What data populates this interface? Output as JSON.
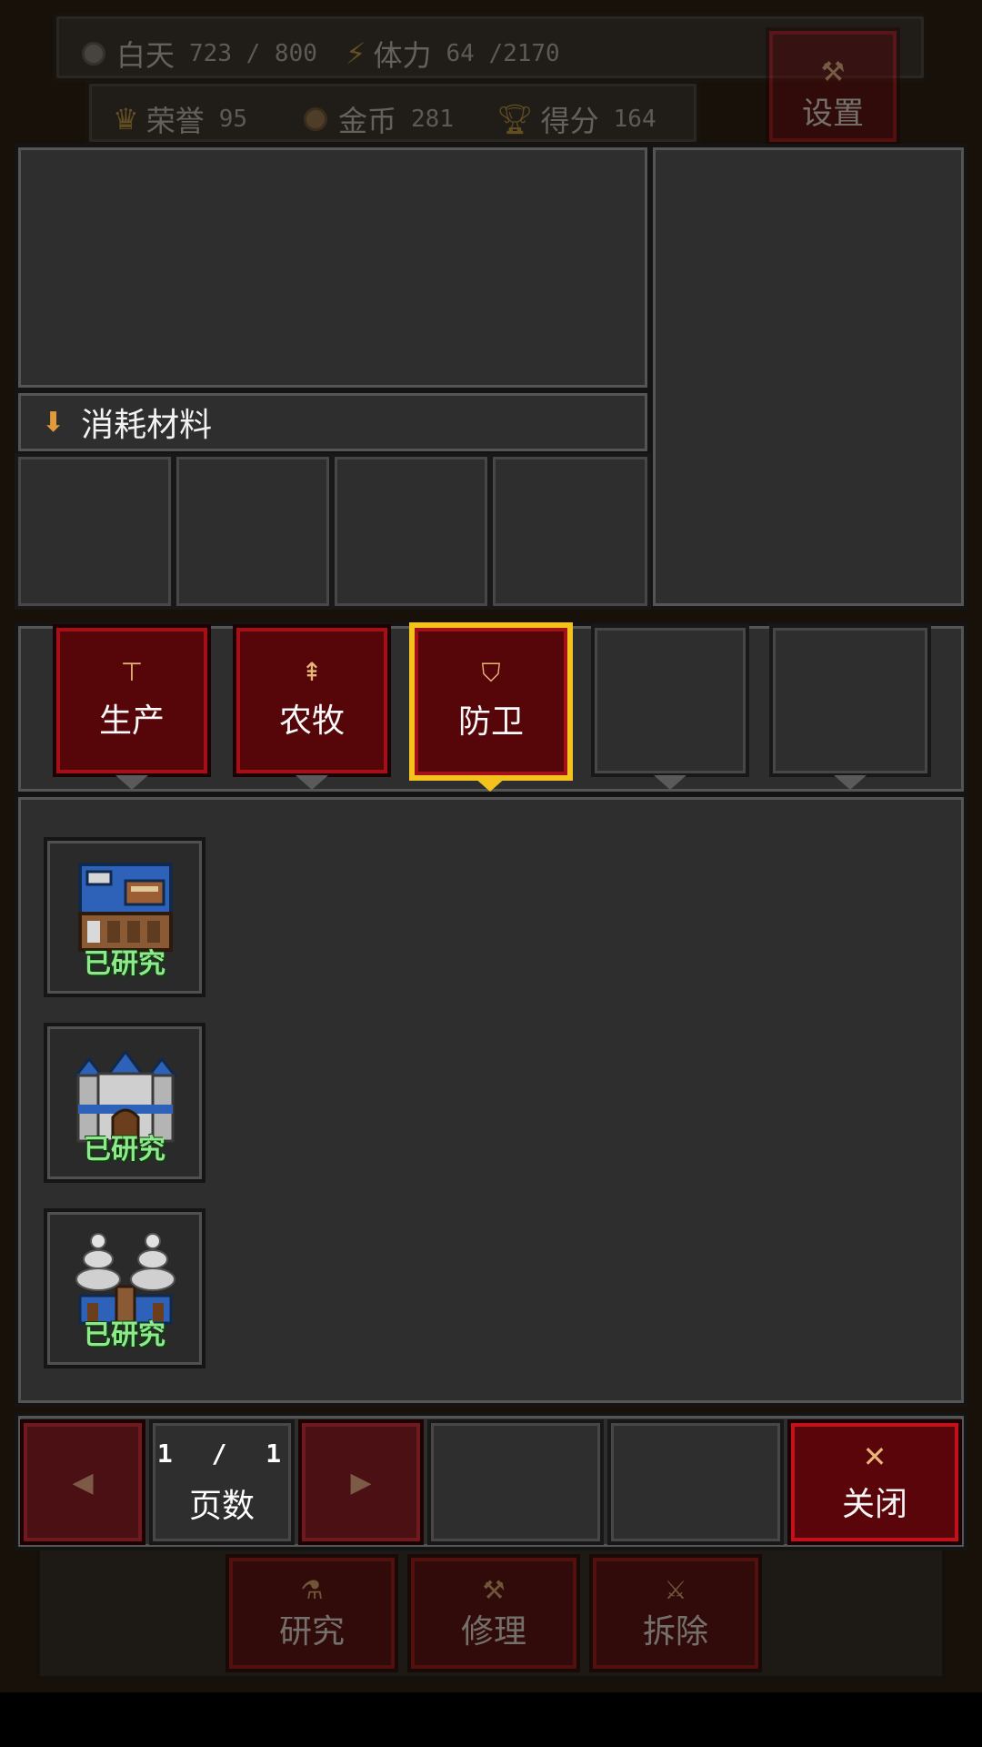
{
  "hud": {
    "day_label": "白天",
    "day_value": "723 / 800",
    "stamina_label": "体力",
    "stamina_value": "64 /2170",
    "honor_label": "荣誉",
    "honor_value": "95",
    "gold_label": "金币",
    "gold_value": "281",
    "score_label": "得分",
    "score_value": "164",
    "settings_label": "设置"
  },
  "materials": {
    "header": "消耗材料"
  },
  "tabs": [
    {
      "label": "生产",
      "icon": "anvil-icon",
      "glyph": "▼",
      "selected": false
    },
    {
      "label": "农牧",
      "icon": "tree-icon",
      "glyph": "▲",
      "selected": false
    },
    {
      "label": "防卫",
      "icon": "shield-icon",
      "glyph": "■",
      "selected": true
    },
    {
      "label": "",
      "selected": false
    },
    {
      "label": "",
      "selected": false
    }
  ],
  "items": [
    {
      "name": "blue-workshop-building",
      "status": "已研究"
    },
    {
      "name": "castle-building",
      "status": "已研究"
    },
    {
      "name": "tower-pair-building",
      "status": "已研究"
    }
  ],
  "pagination": {
    "page": "1",
    "separator": "/",
    "total": "1",
    "label": "页数",
    "prev_glyph": "◀",
    "next_glyph": "▶"
  },
  "close": {
    "glyph": "✕",
    "label": "关闭"
  },
  "bottom_bar": {
    "research_label": "研究",
    "repair_label": "修理",
    "demolish_label": "拆除"
  },
  "colors": {
    "accent_red": "#a31017",
    "selected_gold": "#f3c21d",
    "researched_green": "#8fe88b"
  }
}
